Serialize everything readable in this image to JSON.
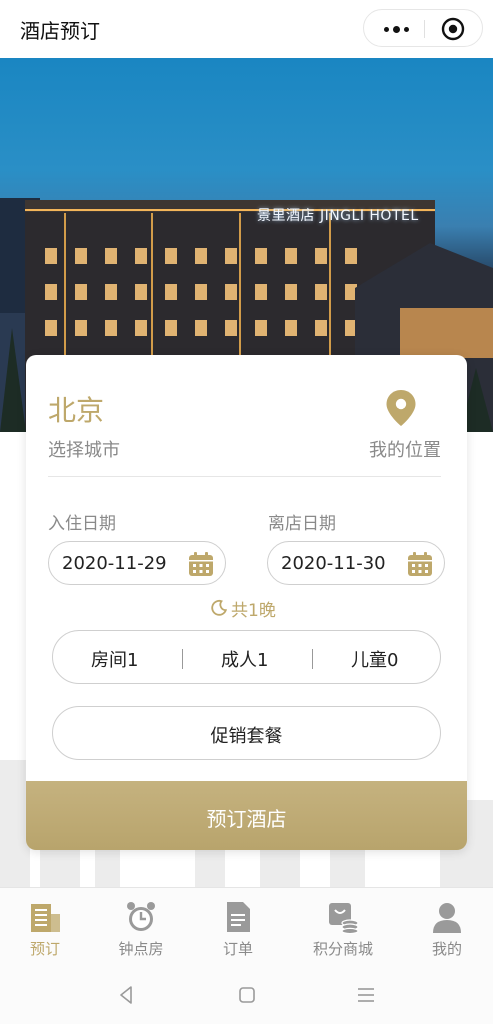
{
  "header": {
    "title": "酒店预订"
  },
  "hero": {
    "sign_text": "景里酒店 JINGLI HOTEL"
  },
  "booking": {
    "city": "北京",
    "city_hint": "选择城市",
    "my_location": "我的位置",
    "checkin_label": "入住日期",
    "checkin_value": "2020-11-29",
    "checkout_label": "离店日期",
    "checkout_value": "2020-11-30",
    "nights": "共1晚",
    "rooms": "房间1",
    "adults": "成人1",
    "children": "儿童0",
    "promo": "促销套餐",
    "book_button": "预订酒店"
  },
  "tabs": [
    {
      "label": "预订",
      "icon": "building-icon",
      "active": true
    },
    {
      "label": "钟点房",
      "icon": "alarm-clock-icon",
      "active": false
    },
    {
      "label": "订单",
      "icon": "document-icon",
      "active": false
    },
    {
      "label": "积分商城",
      "icon": "points-mall-icon",
      "active": false
    },
    {
      "label": "我的",
      "icon": "user-icon",
      "active": false
    }
  ],
  "colors": {
    "accent": "#bea86b",
    "button": "#bea86b",
    "muted": "#8a8a8a"
  }
}
